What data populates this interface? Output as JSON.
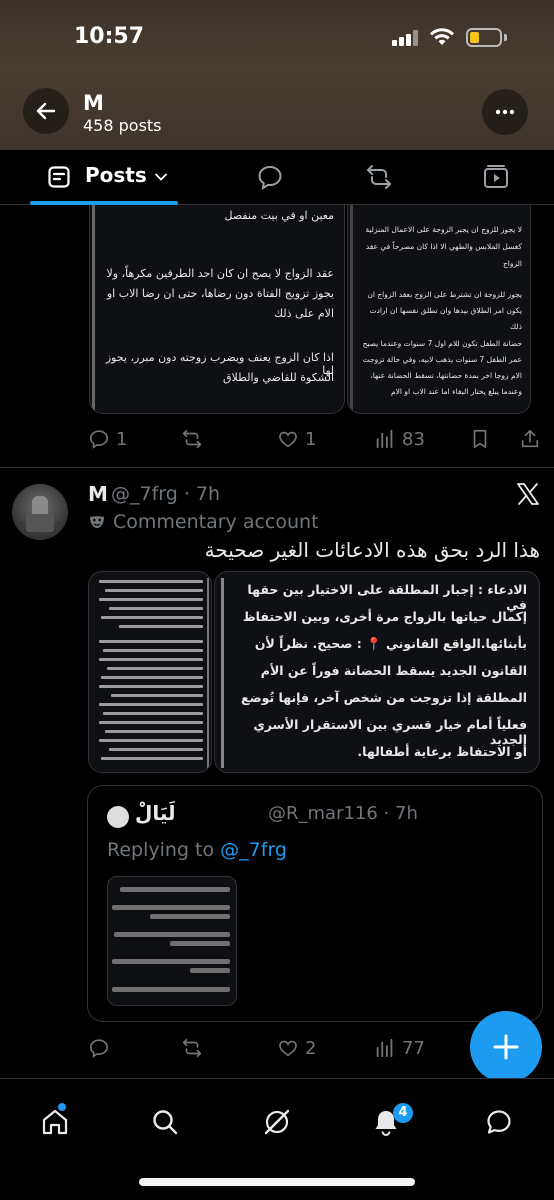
{
  "status_bar": {
    "time": "10:57"
  },
  "profile": {
    "name": "M",
    "posts_count": "458 posts"
  },
  "tabs": {
    "posts_label": "Posts"
  },
  "post1": {
    "image_left_lines": [
      "معين او في بيت منفصل",
      "عقد الزواج لا يصح ان كان احد الطرفين مكرهاً، ولا",
      "يجوز تزويج الفتاة دون رضاها، حتى ان رضا الاب او",
      "الام على ذلك",
      "اذا كان الزوج يعنف ويضرب زوجته دون مبرر، يجوز لها",
      "الشكوة للقاضي والطلاق"
    ],
    "image_right_lines": [
      "لا يجوز للزوج ان يجبر الزوجة على الاعمال المنزلية",
      "كغسل الملابس والطهي الا اذا كان مصرحاً في عقد",
      "الزواج",
      "يجوز للزوجة ان تشترط على الزوج بعقد الزواج ان",
      "يكون امر الطلاق بيدها وان تطلق نفسها ان ارادت",
      "ذلك",
      "حضانة الطفل تكون للام اول 7 سنوات وعندما يصبح",
      "عمر الطفل 7 سنوات يذهب لابيه، وفي حالة تزوجت",
      "الام زوجا اخر بمدة حضانتها، تسقط الحضانة عنها،",
      "وعندما يبلغ يختار البقاء اما عند الاب او الام"
    ],
    "replies": "1",
    "reposts": "",
    "likes": "1",
    "views": "83"
  },
  "post2": {
    "name": "M",
    "handle": "@_7frg · 7h",
    "account_label": "Commentary account",
    "text": "هذا الرد بحق هذه الادعائات الغير صحيحة",
    "image_right_lines": [
      "الادعاء : إجبار المطلقة على الاختيار بين حقها في",
      "إكمال حياتها بالزواج مرة أخرى، وبين الاحتفاظ",
      "بأبنائها.الواقع القانوني 📍 : صحيح. نظراً لأن",
      "القانون الجديد يسقط الحضانة فوراً عن الأم",
      "المطلقة إذا تزوجت من شخص آخر، فإنها تُوضع",
      "فعلياً أمام خيار قسري بين الاستقرار الأسري الجديد",
      "أو الاحتفاظ برعاية أطفالها."
    ],
    "replies": "",
    "reposts": "",
    "likes": "2",
    "views": "77",
    "quote": {
      "name": "لَيَالْ",
      "handle": "@R_mar116 · 7h",
      "replying_prefix": "Replying to",
      "replying_handle": "@_7frg"
    }
  },
  "bottom_nav": {
    "notifications_badge": "4"
  },
  "colors": {
    "accent": "#1d9bf0",
    "muted": "#71767b",
    "divider": "#2f3336"
  }
}
